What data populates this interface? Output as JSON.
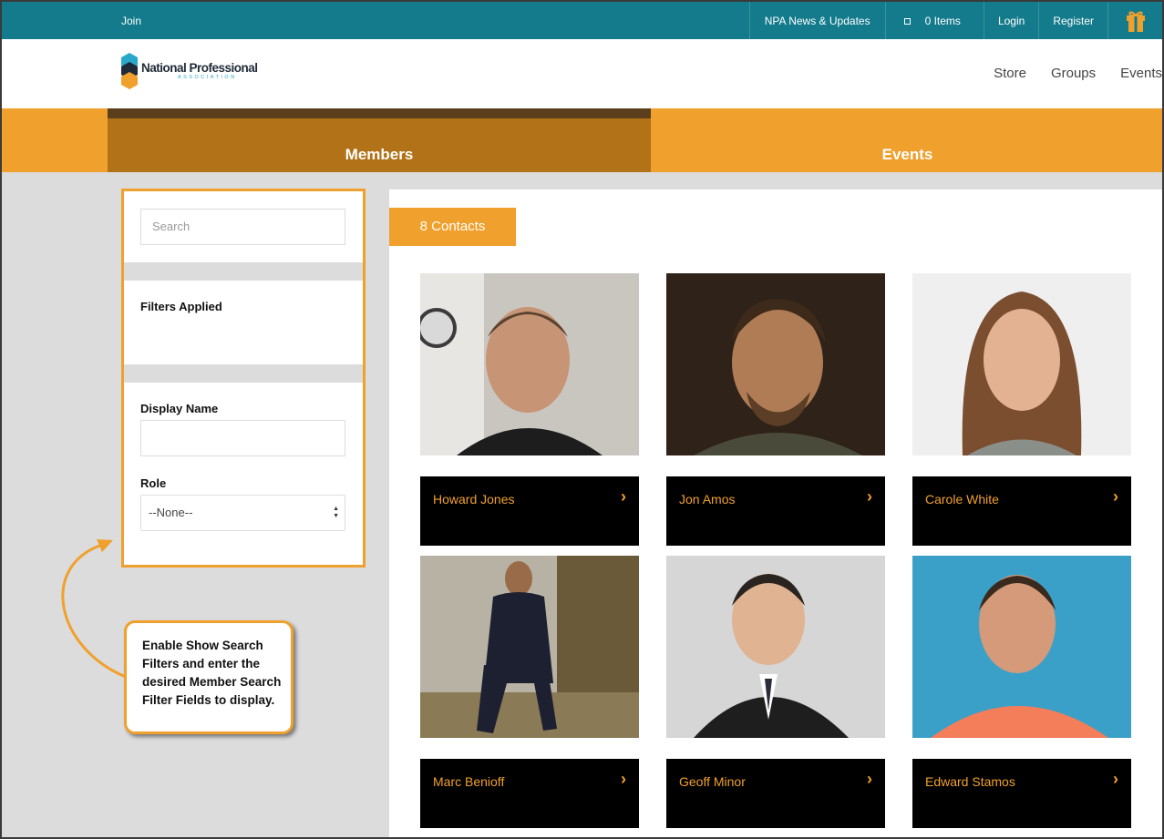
{
  "topbar": {
    "join": "Join",
    "news": "NPA News & Updates",
    "cart": "0 Items",
    "login": "Login",
    "register": "Register"
  },
  "logo": {
    "name": "National Professional",
    "sub": "ASSOCIATION"
  },
  "nav": {
    "store": "Store",
    "groups": "Groups",
    "events": "Events"
  },
  "tabs": {
    "members": "Members",
    "events": "Events"
  },
  "filters": {
    "search_placeholder": "Search",
    "filters_applied": "Filters Applied",
    "display_name": "Display Name",
    "role": "Role",
    "role_value": "--None--"
  },
  "callout": "Enable Show Search Filters and enter the desired Member Search Filter Fields to display.",
  "contacts_count": "8 Contacts",
  "contacts": [
    {
      "name": "Howard Jones"
    },
    {
      "name": "Jon Amos"
    },
    {
      "name": "Carole White"
    },
    {
      "name": "Marc Benioff"
    },
    {
      "name": "Geoff Minor"
    },
    {
      "name": "Edward Stamos"
    }
  ],
  "colors": {
    "teal": "#137b8c",
    "orange": "#f0a02c",
    "brown": "#b27318"
  }
}
